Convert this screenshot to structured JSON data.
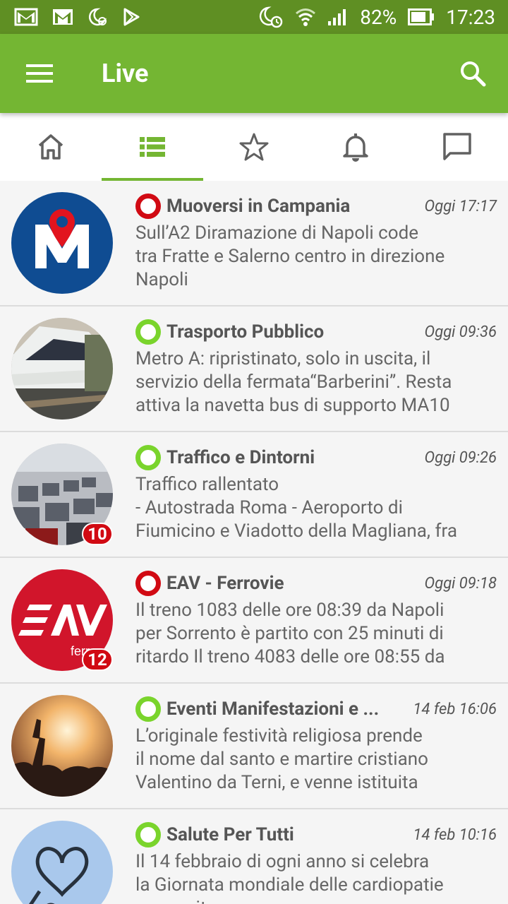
{
  "statusbar": {
    "battery": "82%",
    "time": "17:23"
  },
  "appbar": {
    "title": "Live"
  },
  "colors": {
    "green": "#74b633",
    "dark_green": "#5f8f23",
    "red": "#d10a13",
    "status_green": "#7ad42c"
  },
  "tabs": [
    {
      "icon": "home-icon"
    },
    {
      "icon": "list-icon",
      "active": true
    },
    {
      "icon": "star-icon"
    },
    {
      "icon": "bell-icon"
    },
    {
      "icon": "chat-icon"
    }
  ],
  "items": [
    {
      "name": "Muoversi in Campania",
      "time": "Oggi 17:17",
      "status": "red",
      "text": "Sull’A2 Diramazione di Napoli code\ntra Fratte e Salerno centro in direzione\nNapoli"
    },
    {
      "name": "Trasporto Pubblico",
      "time": "Oggi 09:36",
      "status": "green",
      "text": "Metro A: ripristinato, solo in uscita, il\nservizio della fermata“Barberini”. Resta\nattiva la navetta bus di supporto MA10"
    },
    {
      "name": "Traffico e Dintorni",
      "time": "Oggi 09:26",
      "status": "green",
      "badge": "10",
      "text": "Traffico rallentato\n- Autostrada Roma - Aeroporto di\nFiumicino e Viadotto della Magliana, fra"
    },
    {
      "name": "EAV - Ferrovie",
      "time": "Oggi 09:18",
      "status": "red",
      "badge": "12",
      "text": "Il treno 1083 delle ore 08:39 da Napoli\nper Sorrento è partito con 25 minuti di\nritardo Il treno 4083 delle ore 08:55 da"
    },
    {
      "name": "Eventi Manifestazioni e ...",
      "time": "14 feb 16:06",
      "status": "green",
      "text": "L’originale festività  religiosa prende\nil nome dal santo e martire cristiano\nValentino da Terni, e venne istituita"
    },
    {
      "name": "Salute Per Tutti",
      "time": "14 feb 10:16",
      "status": "green",
      "text": "Il 14 febbraio di ogni anno si celebra\nla Giornata mondiale delle cardiopatie\ncongenite"
    }
  ]
}
